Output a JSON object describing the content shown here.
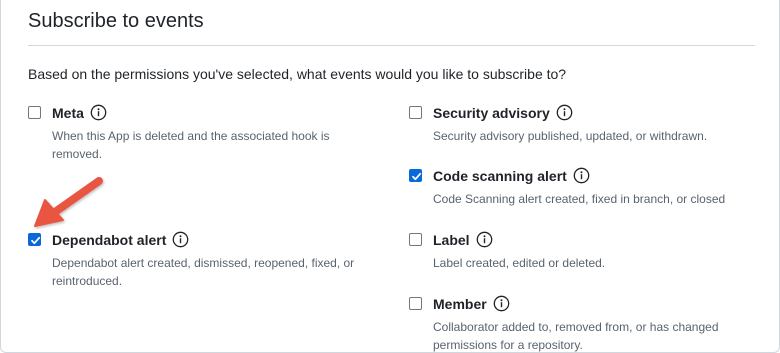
{
  "section": {
    "heading": "Subscribe to events",
    "intro": "Based on the permissions you've selected, what events would you like to subscribe to?"
  },
  "events": {
    "meta": {
      "title": "Meta",
      "description": "When this App is deleted and the associated hook is removed.",
      "checked": false
    },
    "security_advisory": {
      "title": "Security advisory",
      "description": "Security advisory published, updated, or withdrawn.",
      "checked": false
    },
    "code_scanning_alert": {
      "title": "Code scanning alert",
      "description": "Code Scanning alert created, fixed in branch, or closed",
      "checked": true
    },
    "dependabot_alert": {
      "title": "Dependabot alert",
      "description": "Dependabot alert created, dismissed, reopened, fixed, or reintroduced.",
      "checked": true
    },
    "label": {
      "title": "Label",
      "description": "Label created, edited or deleted.",
      "checked": false
    },
    "member": {
      "title": "Member",
      "description": "Collaborator added to, removed from, or has changed permissions for a repository.",
      "checked": false
    }
  },
  "icons": {
    "info": "info-icon",
    "checkmark": "checkmark-icon",
    "annotation_arrow": "arrow-icon"
  },
  "colors": {
    "checkbox_checked": "#0969da",
    "annotation_arrow": "#e8553f",
    "muted_text": "#59636e"
  }
}
